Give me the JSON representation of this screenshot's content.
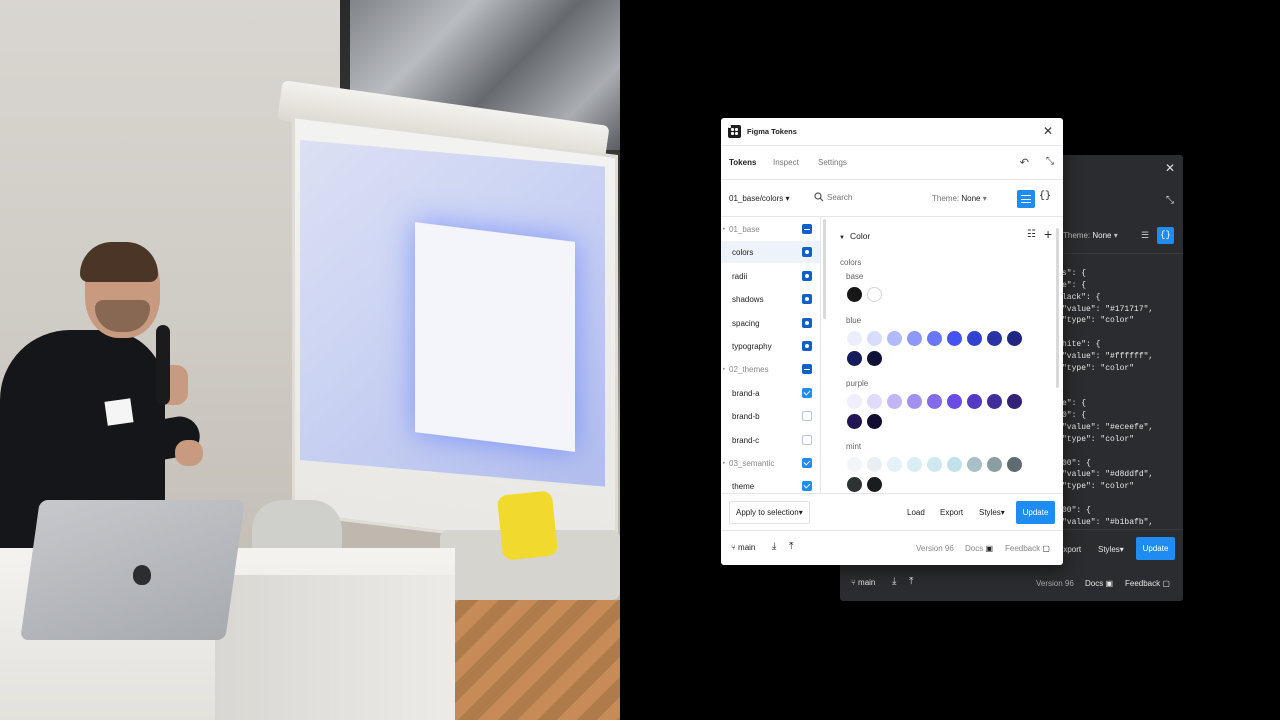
{
  "photo": {
    "description_icon": "presenter-photo"
  },
  "light": {
    "title": "Figma Tokens",
    "tabs": [
      "Tokens",
      "Inspect",
      "Settings"
    ],
    "set_selector": "01_base/colors",
    "search_placeholder": "Search",
    "theme_label": "Theme:",
    "theme_value": "None",
    "sets": [
      {
        "label": "01_base",
        "kind": "folder",
        "state": "partial"
      },
      {
        "label": "colors",
        "kind": "leaf",
        "state": "source",
        "active": true
      },
      {
        "label": "radii",
        "kind": "leaf",
        "state": "source"
      },
      {
        "label": "shadows",
        "kind": "leaf",
        "state": "source"
      },
      {
        "label": "spacing",
        "kind": "leaf",
        "state": "source"
      },
      {
        "label": "typography",
        "kind": "leaf",
        "state": "source"
      },
      {
        "label": "02_themes",
        "kind": "folder",
        "state": "partial"
      },
      {
        "label": "brand-a",
        "kind": "leaf",
        "state": "checked"
      },
      {
        "label": "brand-b",
        "kind": "leaf",
        "state": "empty"
      },
      {
        "label": "brand-c",
        "kind": "leaf",
        "state": "empty"
      },
      {
        "label": "03_semantic",
        "kind": "folder",
        "state": "checked"
      },
      {
        "label": "theme",
        "kind": "leaf",
        "state": "checked"
      }
    ],
    "group_title": "Color",
    "group_name": "colors",
    "color_groups": [
      {
        "name": "base",
        "swatches": [
          "#171717",
          "#ffffff"
        ]
      },
      {
        "name": "blue",
        "swatches": [
          "#eceefe",
          "#d8ddfd",
          "#b1bafb",
          "#8d98f8",
          "#6a76f4",
          "#4653f0",
          "#3341d1",
          "#2833a8",
          "#1f2783",
          "#151b5c",
          "#0e1238"
        ]
      },
      {
        "name": "purple",
        "swatches": [
          "#f0edfd",
          "#e0dafb",
          "#c1b5f6",
          "#a290f0",
          "#836bea",
          "#6a4be3",
          "#5339c4",
          "#422d9d",
          "#332278",
          "#211653",
          "#120c30"
        ]
      },
      {
        "name": "mint",
        "swatches": [
          "#f3f6f8",
          "#eaf0f2",
          "#e2f2f6",
          "#d8eef4",
          "#cde8ef",
          "#c1e2ea",
          "#a7bfc5",
          "#8a9ea2",
          "#5f6b6d",
          "#2c3133",
          "#1a1d1e"
        ]
      }
    ],
    "footer": {
      "apply": "Apply to selection",
      "load": "Load",
      "export": "Export",
      "styles": "Styles",
      "update": "Update",
      "branch": "main",
      "version": "Version 96",
      "docs": "Docs",
      "feedback": "Feedback"
    }
  },
  "dark": {
    "theme_label": "Theme:",
    "theme_value": "None",
    "code_lines": [
      "s\": {",
      "e\": {",
      "lack\": {",
      "\"value\": \"#171717\",",
      "\"type\": \"color\"",
      "",
      "hite\": {",
      "\"value\": \"#ffffff\",",
      "\"type\": \"color\"",
      "",
      "",
      "e\": {",
      "0\": {",
      "\"value\": \"#eceefe\",",
      "\"type\": \"color\"",
      "",
      "00\": {",
      "\"value\": \"#d8ddfd\",",
      "\"type\": \"color\"",
      "",
      "00\": {",
      "\"value\": \"#b1bafb\","
    ],
    "footer": {
      "export": "Export",
      "styles": "Styles",
      "update": "Update",
      "branch": "main",
      "version": "Version 96",
      "docs": "Docs",
      "feedback": "Feedback"
    }
  },
  "colors": {
    "accent": "#1f8cf2",
    "dark_bg": "#2b2c2f",
    "page_bg": "#000000"
  }
}
